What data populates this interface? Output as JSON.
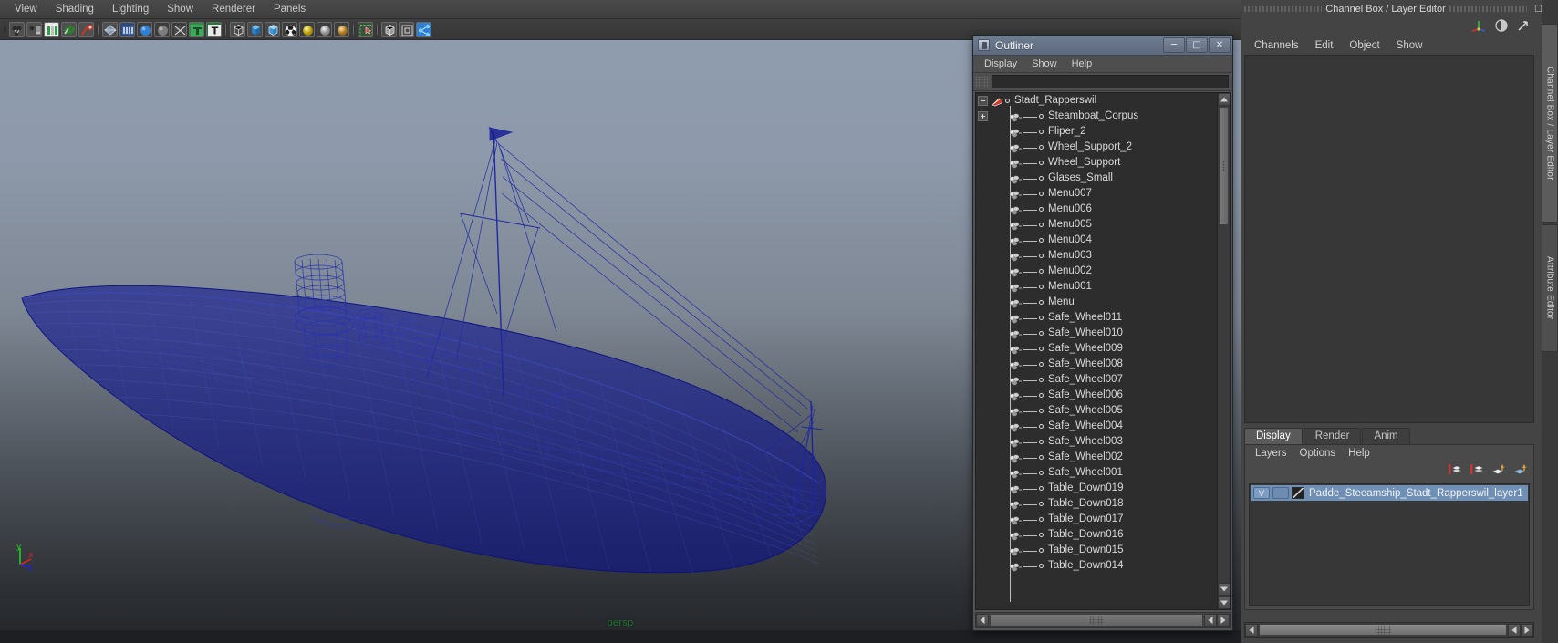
{
  "app": {
    "viewport_menu": [
      "View",
      "Shading",
      "Lighting",
      "Show",
      "Renderer",
      "Panels"
    ],
    "viewport_camera_label": "persp",
    "axis_labels": {
      "y": "y",
      "x": "x",
      "z": "z"
    },
    "axis_colors": {
      "y": "#22cc22",
      "x": "#dd2222",
      "z": "#2222dd"
    },
    "wireframe_color": "#0b1290",
    "toolbar_icons": [
      "select-by-hierarchy-icon",
      "select-by-object-type-icon",
      "select-by-component-type-icon",
      "highlight-selection-mode-icon",
      "select-handle-icon",
      "xray-shading-icon",
      "xray-joints-icon",
      "shaded-sphere-icon",
      "texture-sphere-icon",
      "lighting-icon",
      "text-display-icon",
      "wireframe-cube-icon",
      "smooth-shade-cube-icon",
      "smooth-shade-all-cube-icon",
      "checker-sphere-icon",
      "light-yellow-sphere-icon",
      "light-grey-sphere-icon",
      "light-amber-sphere-icon",
      "marquee-select-icon",
      "bounding-box-cube-icon",
      "isolate-select-icon",
      "share-icon"
    ]
  },
  "outliner": {
    "title": "Outliner",
    "window_buttons": [
      "minimize-button",
      "maximize-button",
      "close-button"
    ],
    "menu": [
      "Display",
      "Show",
      "Help"
    ],
    "search_value": "",
    "search_placeholder": "",
    "items": [
      {
        "label": "Stadt_Rapperswil",
        "depth": 0,
        "expander": "minus",
        "icon": "transform-group-icon"
      },
      {
        "label": "Steamboat_Corpus",
        "depth": 1,
        "expander": "plus",
        "icon": "mesh-node-icon"
      },
      {
        "label": "Fliper_2",
        "depth": 1,
        "expander": "none",
        "icon": "mesh-node-icon"
      },
      {
        "label": "Wheel_Support_2",
        "depth": 1,
        "expander": "none",
        "icon": "mesh-node-icon"
      },
      {
        "label": "Wheel_Support",
        "depth": 1,
        "expander": "none",
        "icon": "mesh-node-icon"
      },
      {
        "label": "Glases_Small",
        "depth": 1,
        "expander": "none",
        "icon": "mesh-node-icon"
      },
      {
        "label": "Menu007",
        "depth": 1,
        "expander": "none",
        "icon": "mesh-node-icon"
      },
      {
        "label": "Menu006",
        "depth": 1,
        "expander": "none",
        "icon": "mesh-node-icon"
      },
      {
        "label": "Menu005",
        "depth": 1,
        "expander": "none",
        "icon": "mesh-node-icon"
      },
      {
        "label": "Menu004",
        "depth": 1,
        "expander": "none",
        "icon": "mesh-node-icon"
      },
      {
        "label": "Menu003",
        "depth": 1,
        "expander": "none",
        "icon": "mesh-node-icon"
      },
      {
        "label": "Menu002",
        "depth": 1,
        "expander": "none",
        "icon": "mesh-node-icon"
      },
      {
        "label": "Menu001",
        "depth": 1,
        "expander": "none",
        "icon": "mesh-node-icon"
      },
      {
        "label": "Menu",
        "depth": 1,
        "expander": "none",
        "icon": "mesh-node-icon"
      },
      {
        "label": "Safe_Wheel011",
        "depth": 1,
        "expander": "none",
        "icon": "mesh-node-icon"
      },
      {
        "label": "Safe_Wheel010",
        "depth": 1,
        "expander": "none",
        "icon": "mesh-node-icon"
      },
      {
        "label": "Safe_Wheel009",
        "depth": 1,
        "expander": "none",
        "icon": "mesh-node-icon"
      },
      {
        "label": "Safe_Wheel008",
        "depth": 1,
        "expander": "none",
        "icon": "mesh-node-icon"
      },
      {
        "label": "Safe_Wheel007",
        "depth": 1,
        "expander": "none",
        "icon": "mesh-node-icon"
      },
      {
        "label": "Safe_Wheel006",
        "depth": 1,
        "expander": "none",
        "icon": "mesh-node-icon"
      },
      {
        "label": "Safe_Wheel005",
        "depth": 1,
        "expander": "none",
        "icon": "mesh-node-icon"
      },
      {
        "label": "Safe_Wheel004",
        "depth": 1,
        "expander": "none",
        "icon": "mesh-node-icon"
      },
      {
        "label": "Safe_Wheel003",
        "depth": 1,
        "expander": "none",
        "icon": "mesh-node-icon"
      },
      {
        "label": "Safe_Wheel002",
        "depth": 1,
        "expander": "none",
        "icon": "mesh-node-icon"
      },
      {
        "label": "Safe_Wheel001",
        "depth": 1,
        "expander": "none",
        "icon": "mesh-node-icon"
      },
      {
        "label": "Table_Down019",
        "depth": 1,
        "expander": "none",
        "icon": "mesh-node-icon"
      },
      {
        "label": "Table_Down018",
        "depth": 1,
        "expander": "none",
        "icon": "mesh-node-icon"
      },
      {
        "label": "Table_Down017",
        "depth": 1,
        "expander": "none",
        "icon": "mesh-node-icon"
      },
      {
        "label": "Table_Down016",
        "depth": 1,
        "expander": "none",
        "icon": "mesh-node-icon"
      },
      {
        "label": "Table_Down015",
        "depth": 1,
        "expander": "none",
        "icon": "mesh-node-icon"
      },
      {
        "label": "Table_Down014",
        "depth": 1,
        "expander": "none",
        "icon": "mesh-node-icon"
      }
    ]
  },
  "right_panel": {
    "title": "Channel Box / Layer Editor",
    "window_buttons": [
      "restore-button",
      "close-button"
    ],
    "channelbox_menu": [
      "Channels",
      "Edit",
      "Object",
      "Show"
    ],
    "layer_editor": {
      "tabs": [
        "Display",
        "Render",
        "Anim"
      ],
      "active_tab": "Display",
      "menu": [
        "Layers",
        "Options",
        "Help"
      ],
      "toolbar_icons": [
        "new-layer-icon",
        "new-layer-from-selected-icon",
        "layer-up-icon",
        "layer-down-icon"
      ],
      "layers": [
        {
          "visibility": "V",
          "playback": "",
          "color_swatch": "#000000",
          "name": "Padde_Steeamship_Stadt_Rapperswil_layer1",
          "selected": true
        }
      ]
    },
    "vertical_tabs": [
      {
        "label": "Channel Box / Layer Editor",
        "selected": true
      },
      {
        "label": "Attribute Editor",
        "selected": false
      }
    ]
  }
}
